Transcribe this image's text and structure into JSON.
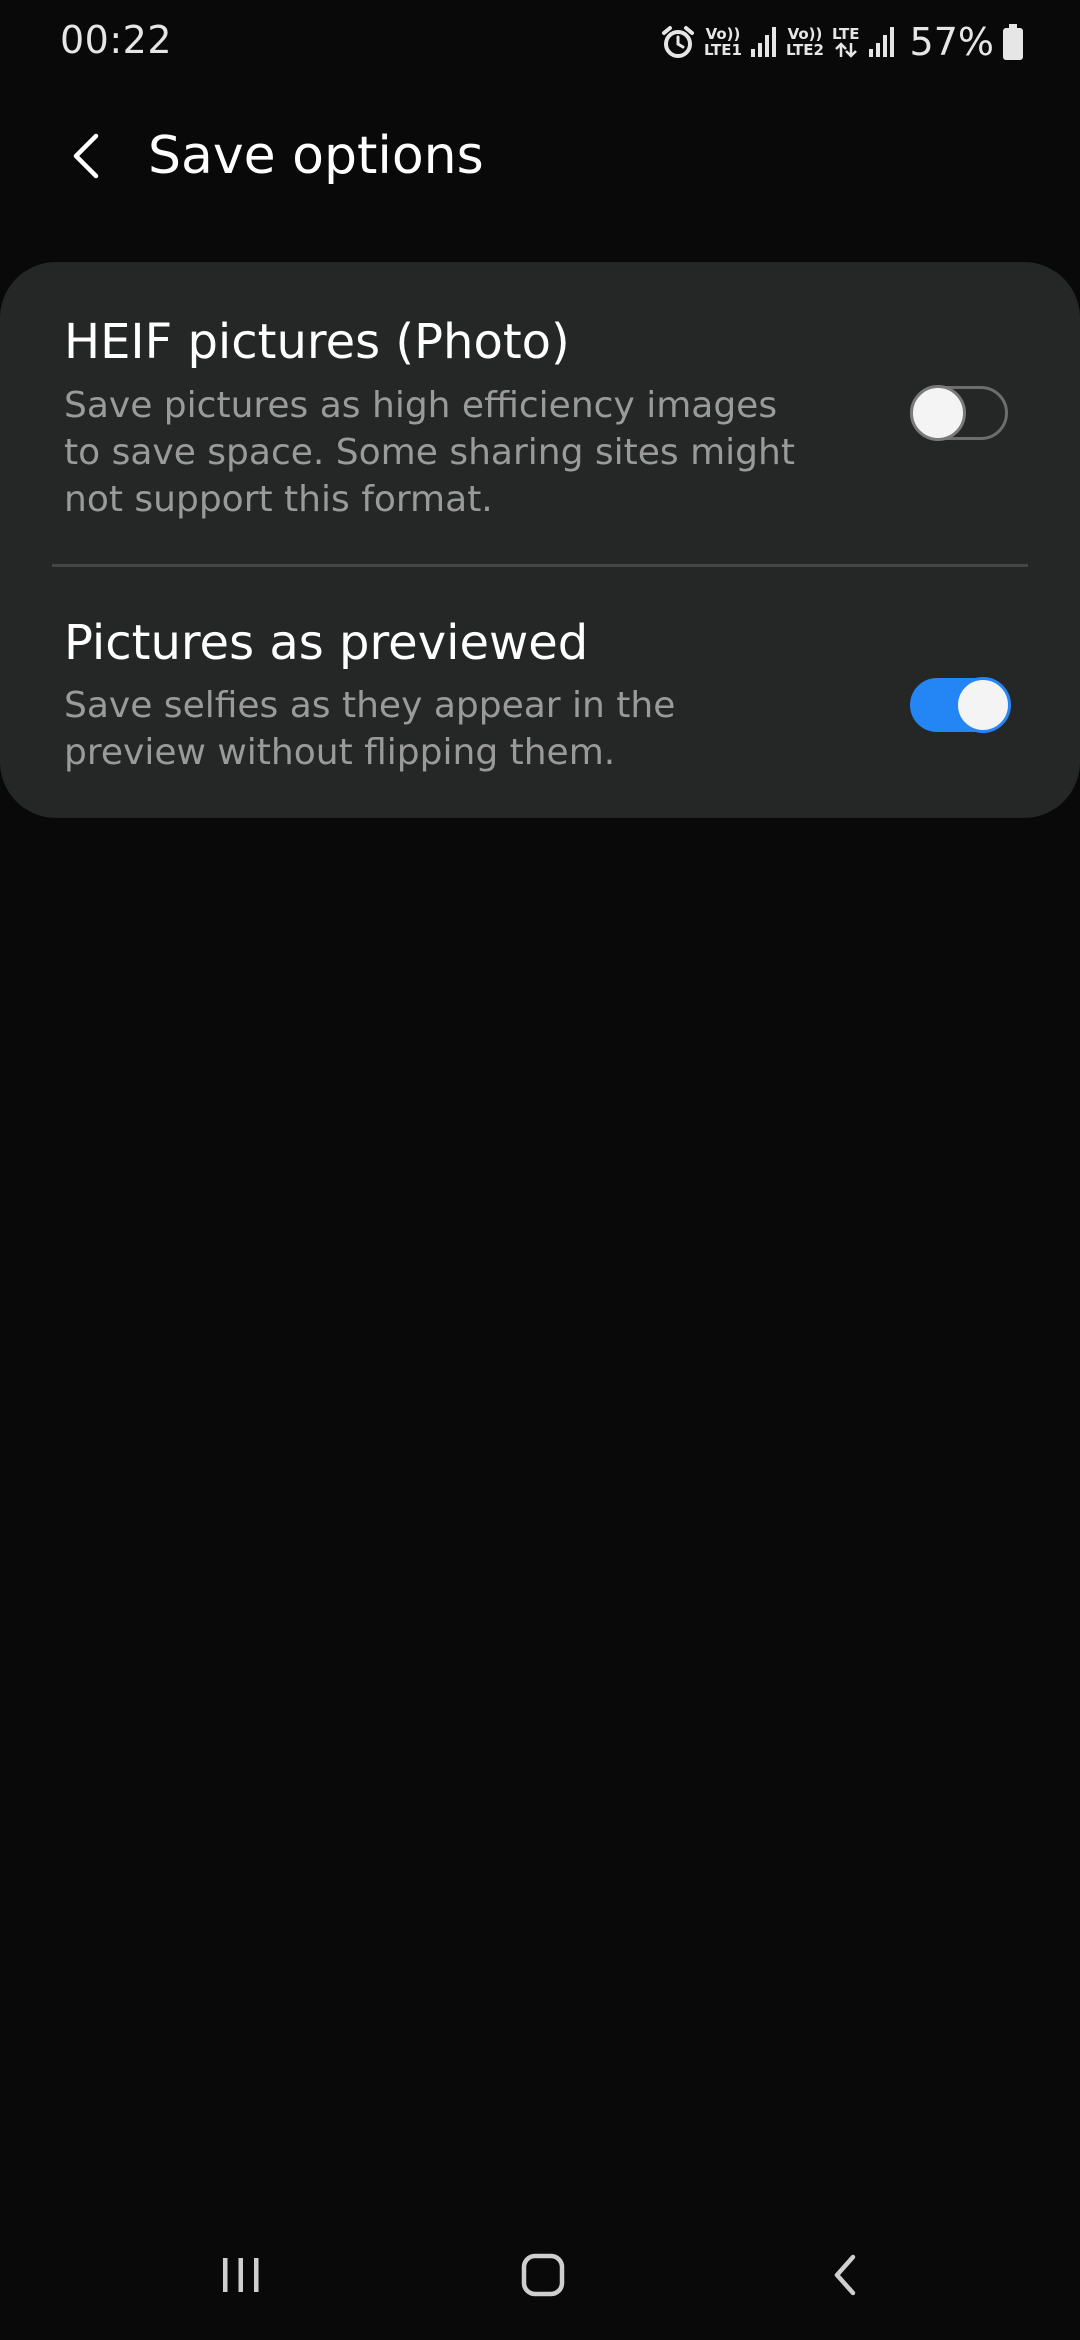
{
  "status_bar": {
    "time": "00:22",
    "sim1_top": "Vo))",
    "sim1_bottom": "LTE1",
    "sim2_top": "Vo))",
    "sim2_bottom": "LTE2",
    "data_label": "LTE",
    "battery_percent": "57%",
    "icons": [
      "alarm-icon",
      "signal-icon",
      "signal-icon",
      "data-arrows-icon",
      "signal-icon",
      "battery-icon"
    ]
  },
  "header": {
    "title": "Save options",
    "back_icon": "chevron-left-icon"
  },
  "settings": [
    {
      "title": "HEIF pictures (Photo)",
      "description": "Save pictures as high efficiency images to save space. Some sharing sites might not support this format.",
      "enabled": false
    },
    {
      "title": "Pictures as previewed",
      "description": "Save selfies as they appear in the preview without flipping them.",
      "enabled": true
    }
  ],
  "nav_bar": {
    "icons": [
      "recents-icon",
      "home-icon",
      "back-icon"
    ]
  },
  "colors": {
    "background": "#090909",
    "card": "#252626",
    "accent": "#2485f5",
    "secondary_text": "#9a9a9a"
  }
}
